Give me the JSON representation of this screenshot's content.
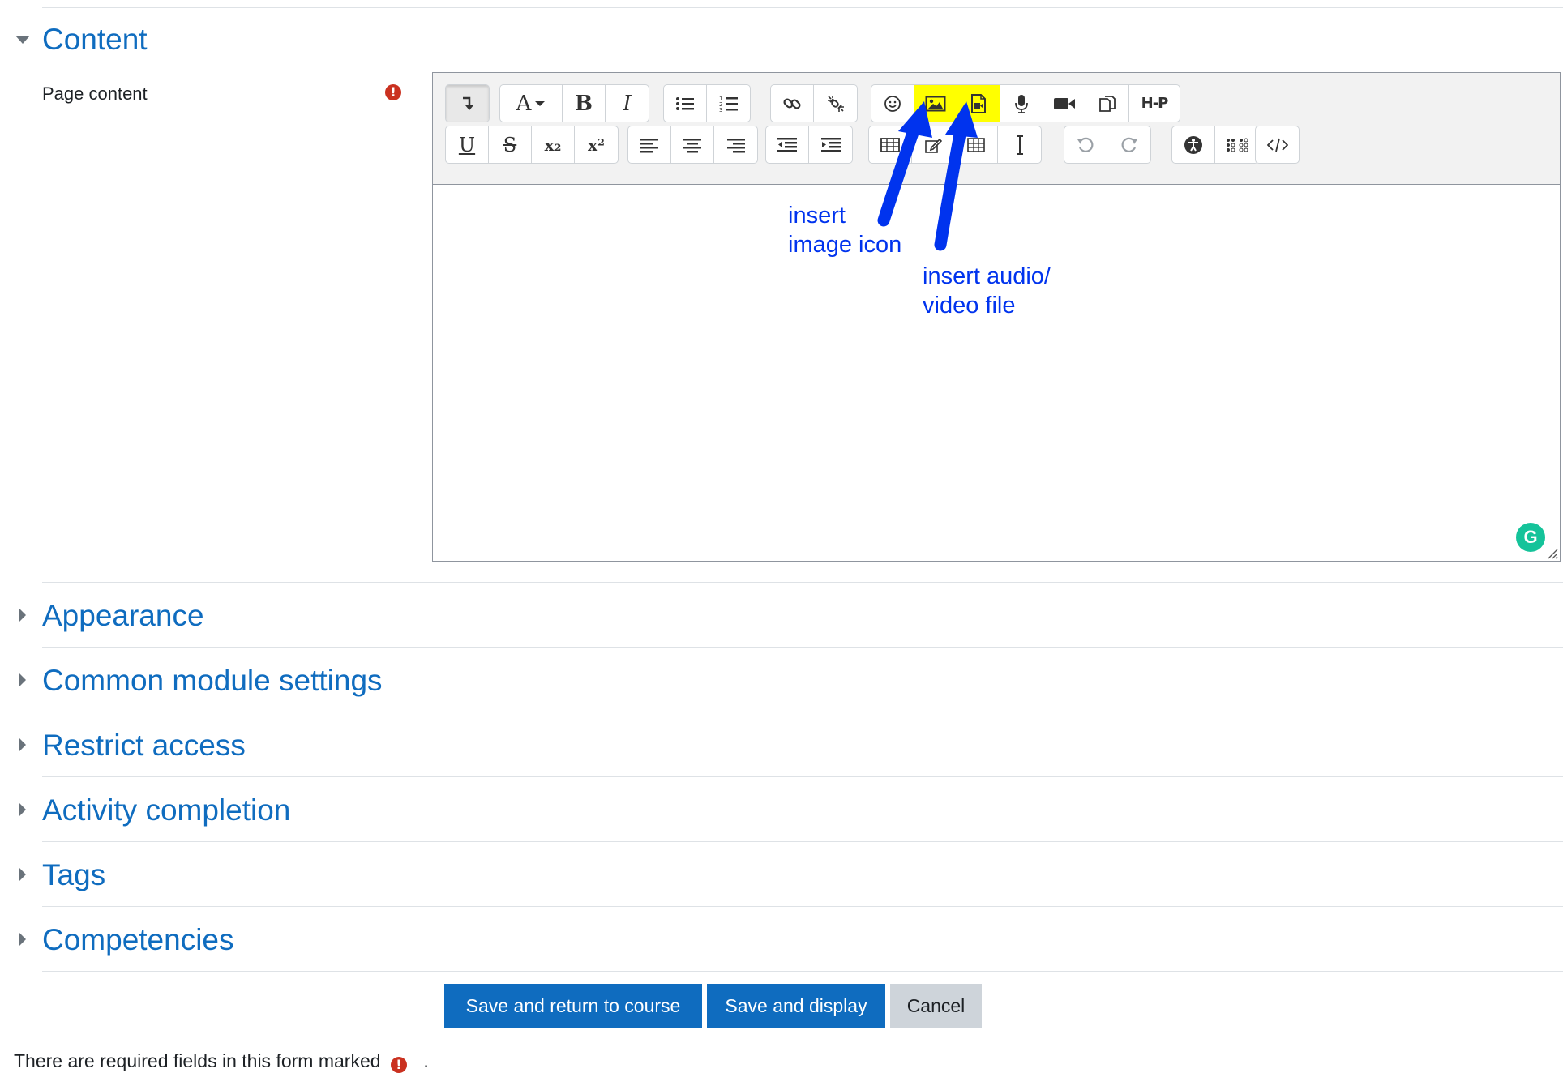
{
  "sections": {
    "content": {
      "title": "Content",
      "expanded": true
    },
    "collapsed": [
      {
        "title": "Appearance"
      },
      {
        "title": "Common module settings"
      },
      {
        "title": "Restrict access"
      },
      {
        "title": "Activity completion"
      },
      {
        "title": "Tags"
      },
      {
        "title": "Competencies"
      }
    ]
  },
  "field": {
    "label": "Page content",
    "required_icon": "!"
  },
  "editor": {
    "toolbar_row1": {
      "font_button": "A",
      "bold": "B",
      "italic": "I",
      "h5p": "H-P"
    },
    "toolbar_row2": {
      "underline": "U",
      "strike": "S",
      "subscript": "x₂",
      "superscript": "x²"
    },
    "highlighted_buttons": [
      "insert-image",
      "insert-media"
    ],
    "highlight_color": "#ffff00",
    "grammarly_badge": "G"
  },
  "annotations": {
    "image_note_line1": "insert",
    "image_note_line2": "image icon",
    "media_note_line1": "insert audio/",
    "media_note_line2": "video file",
    "arrow_color": "#0033ee"
  },
  "buttons": {
    "save_return": "Save and return to course",
    "save_display": "Save and display",
    "cancel": "Cancel"
  },
  "footer": {
    "text": "There are required fields in this form marked",
    "marker": "!",
    "period": "."
  },
  "colors": {
    "link": "#0f6cbf",
    "primary": "#0f6cbf",
    "required": "#ca3120"
  }
}
